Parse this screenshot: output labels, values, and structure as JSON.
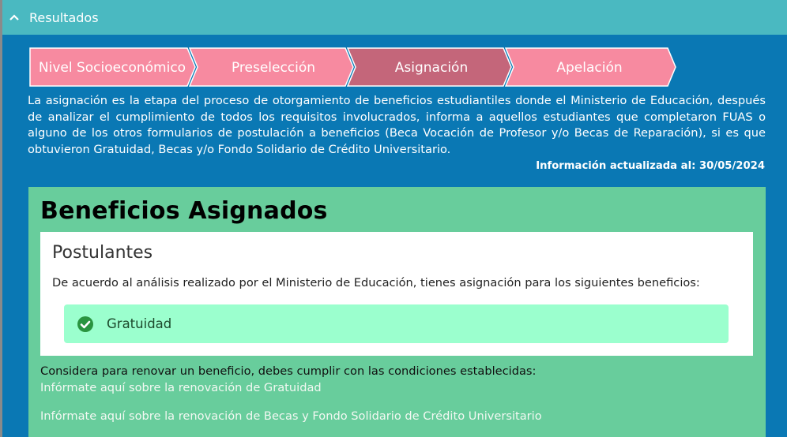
{
  "header": {
    "title": "Resultados",
    "chevron_icon": "chevron-up-icon"
  },
  "steps": [
    {
      "label": "Nivel Socioeconómico",
      "active": false
    },
    {
      "label": "Preselección",
      "active": false
    },
    {
      "label": "Asignación",
      "active": true
    },
    {
      "label": "Apelación",
      "active": false
    }
  ],
  "step_colors": {
    "inactive": "#f78aa0",
    "active": "#c4667a",
    "border": "#ffffff"
  },
  "description": "La asignación es la etapa del proceso de otorgamiento de beneficios estudiantiles donde el Ministerio de Educación, después de analizar el cumplimiento de todos los requisitos involucrados, informa a aquellos estudiantes que completaron FUAS o alguno de los otros formularios de postulación a beneficios (Beca Vocación de Profesor y/o Becas de Reparación), si es que obtuvieron Gratuidad, Becas y/o Fondo Solidario de Crédito Universitario.",
  "updated": "Información actualizada al: 30/05/2024",
  "benefits": {
    "title": "Beneficios Asignados",
    "card": {
      "title": "Postulantes",
      "text": "De acuerdo al análisis realizado por el Ministerio de Educación, tienes asignación para los siguientes beneficios:",
      "items": [
        {
          "label": "Gratuidad",
          "icon": "check-circle-icon"
        }
      ]
    },
    "note": "Considera para renovar un beneficio, debes cumplir con las condiciones establecidas:",
    "links": [
      "Infórmate aquí sobre la renovación de Gratuidad",
      "Infórmate aquí sobre la renovación de Becas y Fondo Solidario de Crédito Universitario"
    ]
  }
}
